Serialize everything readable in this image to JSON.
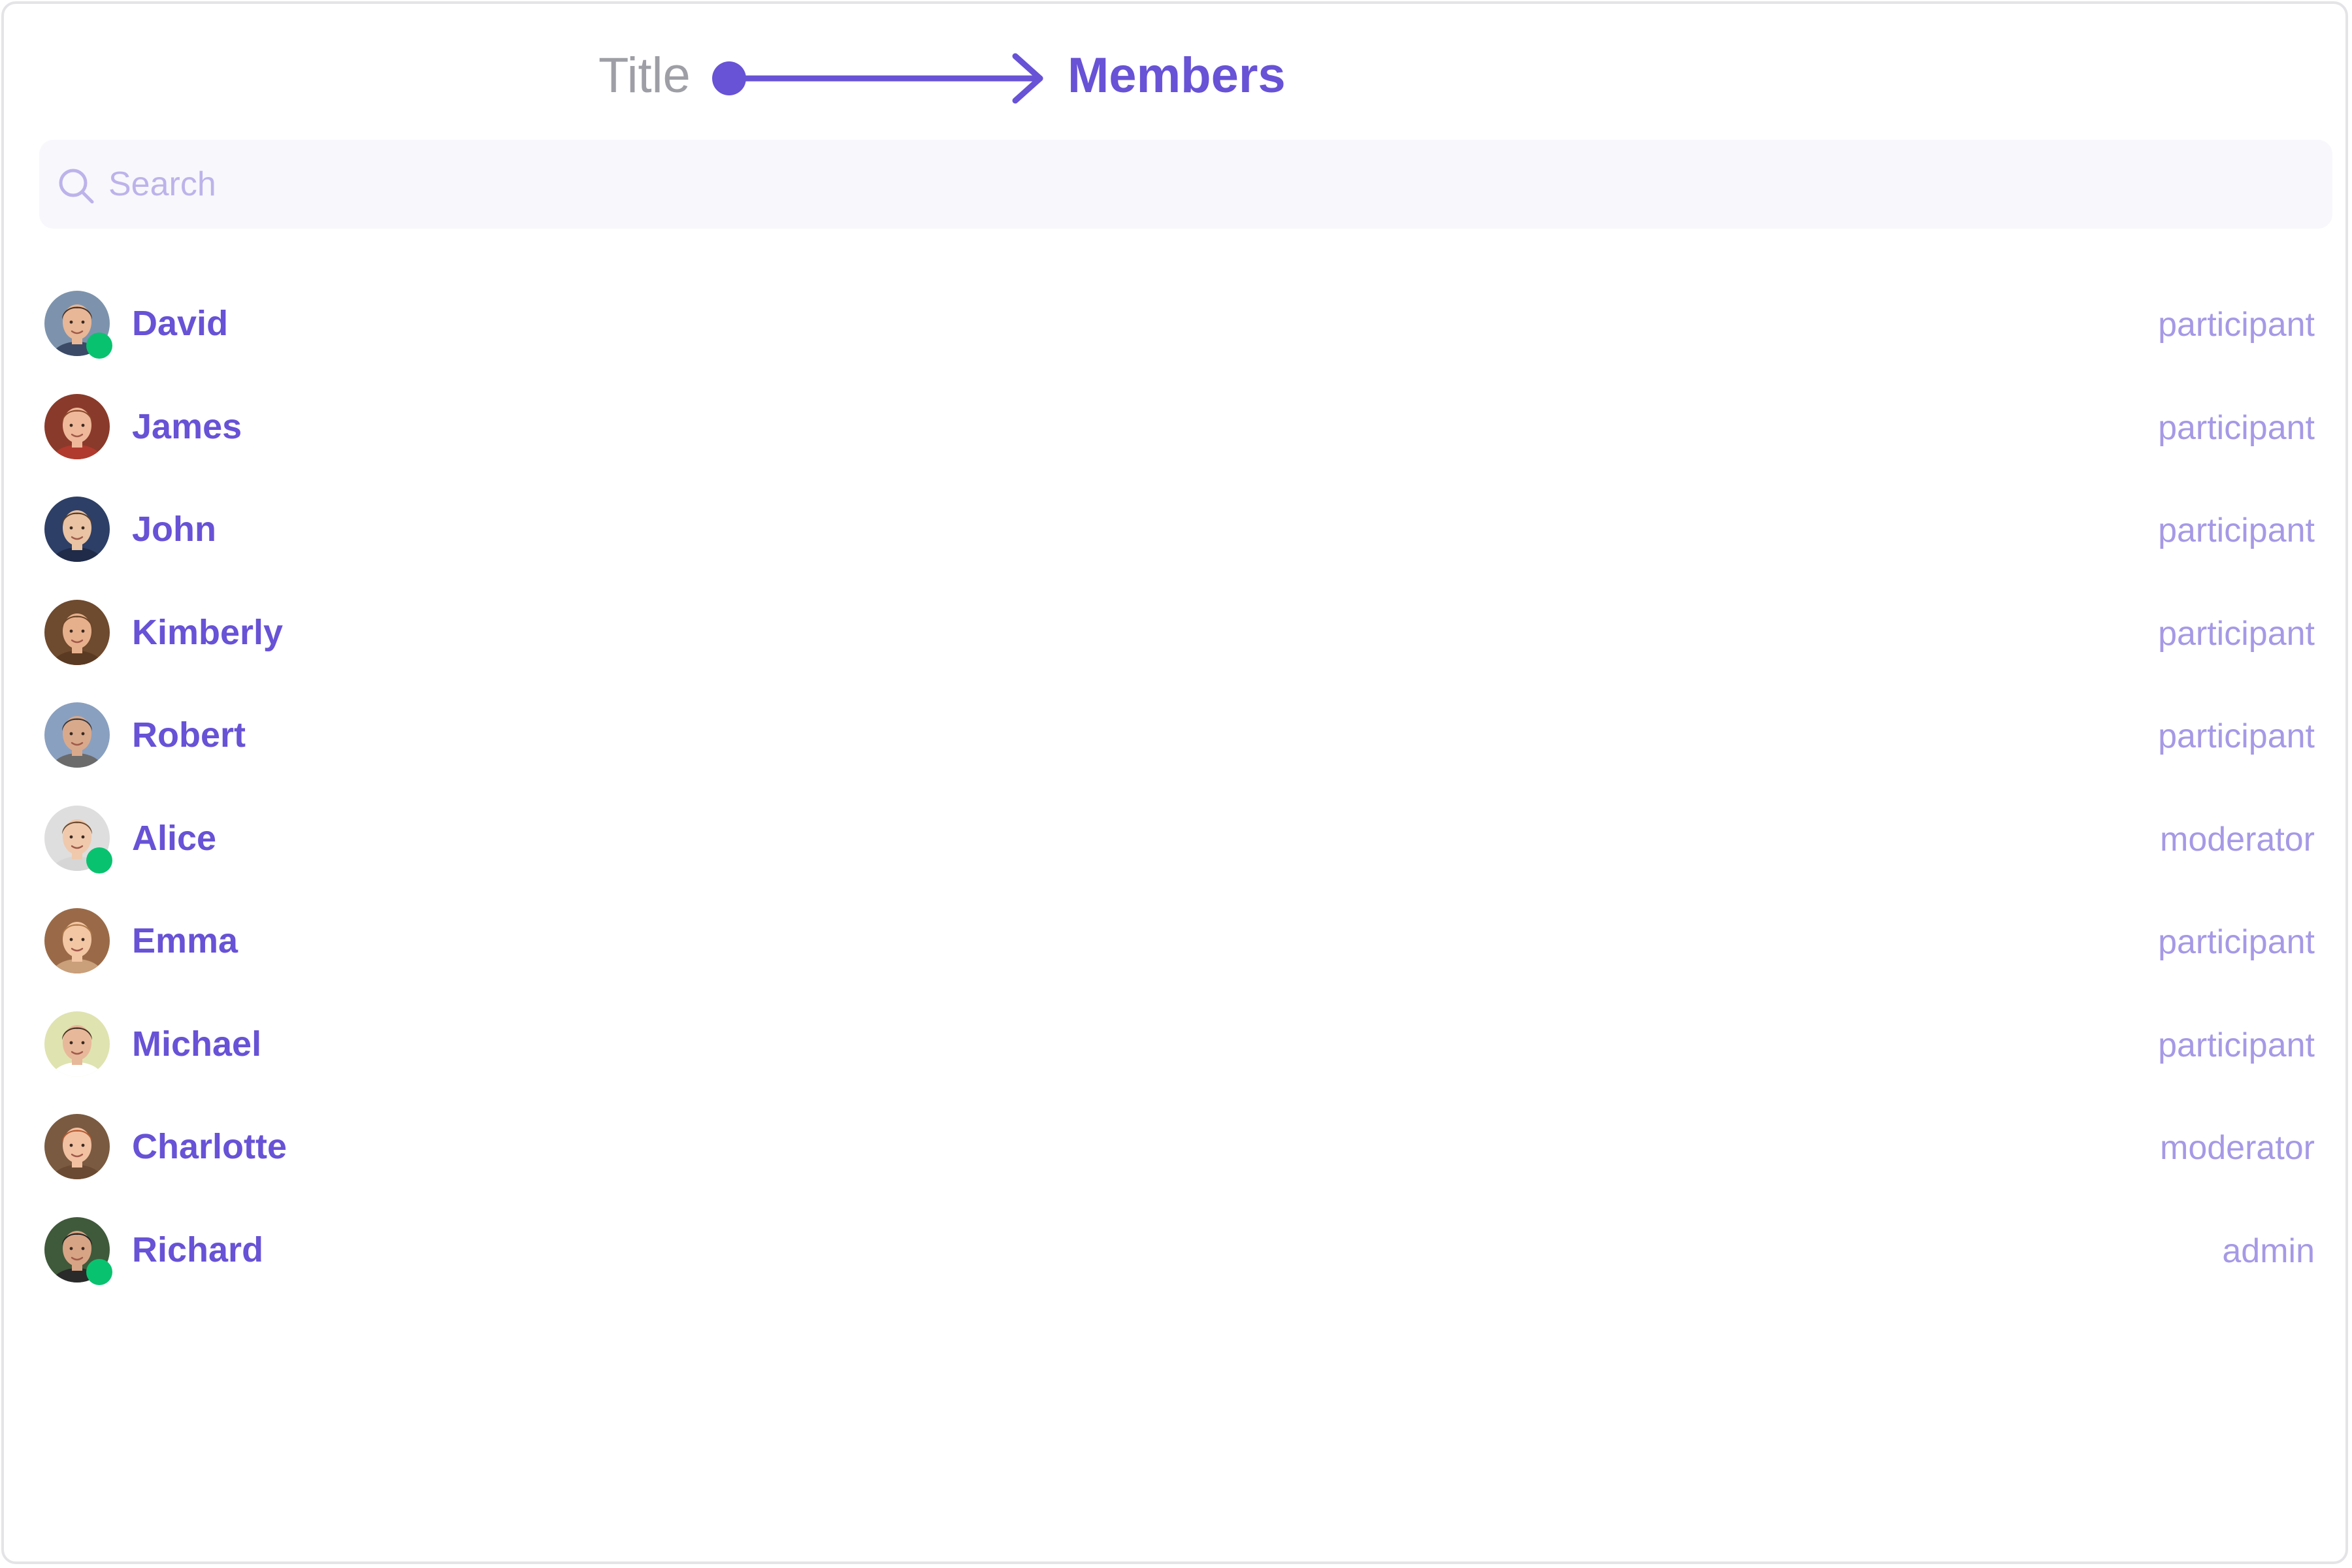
{
  "annotation": {
    "label": "Title"
  },
  "header": {
    "title": "Members"
  },
  "search": {
    "placeholder": "Search",
    "value": ""
  },
  "colors": {
    "accent": "#6852d6",
    "role_text": "#a699e6",
    "online": "#09c26f",
    "search_bg": "#f8f7fc",
    "annotation_text": "#9e9ea6"
  },
  "members": [
    {
      "name": "David",
      "role": "participant",
      "online": true
    },
    {
      "name": "James",
      "role": "participant",
      "online": false
    },
    {
      "name": "John",
      "role": "participant",
      "online": false
    },
    {
      "name": "Kimberly",
      "role": "participant",
      "online": false
    },
    {
      "name": "Robert",
      "role": "participant",
      "online": false
    },
    {
      "name": "Alice",
      "role": "moderator",
      "online": true
    },
    {
      "name": "Emma",
      "role": "participant",
      "online": false
    },
    {
      "name": "Michael",
      "role": "participant",
      "online": false
    },
    {
      "name": "Charlotte",
      "role": "moderator",
      "online": false
    },
    {
      "name": "Richard",
      "role": "admin",
      "online": true
    }
  ]
}
